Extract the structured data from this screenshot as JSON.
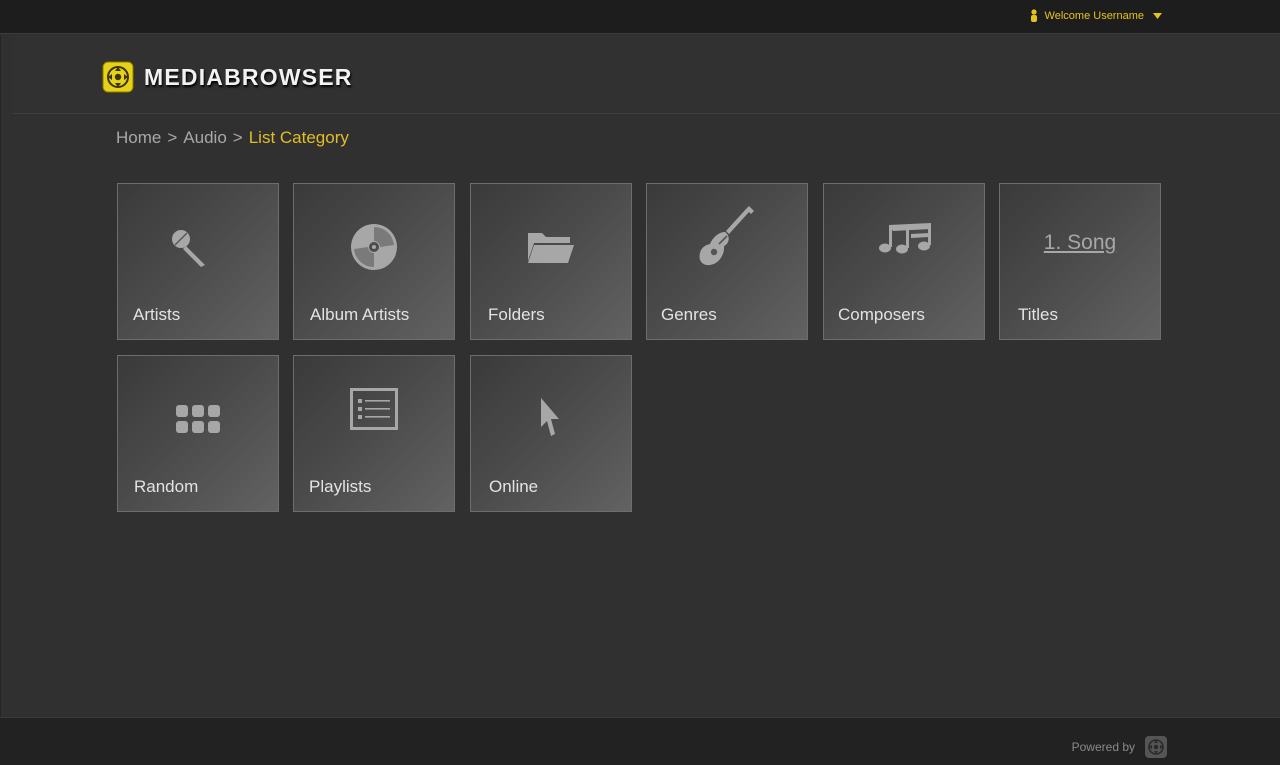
{
  "user_menu": {
    "label": "Welcome Username",
    "icon": "user-icon",
    "caret_icon": "chevron-down-icon"
  },
  "logo": {
    "text": "MEDIABROWSER",
    "icon": "mediabrowser-logo-icon",
    "accent": "#e6d21a"
  },
  "breadcrumb": {
    "items": [
      "Home",
      "Audio"
    ],
    "separator": ">",
    "current": "List Category"
  },
  "tiles": [
    {
      "label": "Artists",
      "icon": "microphone-icon"
    },
    {
      "label": "Album Artists",
      "icon": "disc-icon"
    },
    {
      "label": "Folders",
      "icon": "folder-icon"
    },
    {
      "label": "Genres",
      "icon": "guitar-icon"
    },
    {
      "label": "Composers",
      "icon": "music-notes-icon"
    },
    {
      "label": "Titles",
      "icon_text": "1. Song"
    },
    {
      "label": "Random",
      "icon": "grid-icon"
    },
    {
      "label": "Playlists",
      "icon": "list-icon"
    },
    {
      "label": "Online",
      "icon": "cursor-icon"
    }
  ],
  "footer": {
    "powered_by": "Powered by",
    "icon": "mediabrowser-logo-icon"
  },
  "colors": {
    "accent": "#e2bd26",
    "background": "#303030",
    "tile_border": "#6d6d6d"
  }
}
